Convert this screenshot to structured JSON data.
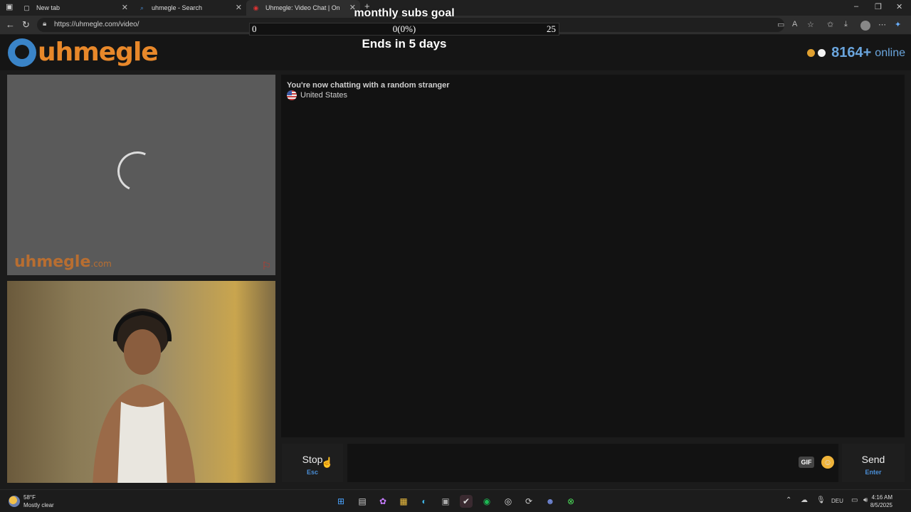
{
  "tabs": [
    {
      "title": "New tab"
    },
    {
      "title": "uhmegle - Search"
    },
    {
      "title": "Uhmegle: Video Chat | Omeg"
    }
  ],
  "address": {
    "url": "https://uhmegle.com/video/"
  },
  "overlay": {
    "goal_title": "monthly subs goal",
    "goal_min": "0",
    "goal_current": "0(0%)",
    "goal_max": "25",
    "goal_progress": 0,
    "goal_ends": "Ends in 5 days"
  },
  "site": {
    "logo_text": "uhmegle",
    "online_count": "8164+",
    "online_label": "online"
  },
  "video": {
    "watermark_main": "uhmegle",
    "watermark_tld": ".com"
  },
  "chat": {
    "status": "You're now chatting with a random stranger",
    "country": "United States"
  },
  "controls": {
    "stop_label": "Stop",
    "stop_key": "Esc",
    "gif_label": "GIF",
    "send_label": "Send",
    "send_key": "Enter"
  },
  "taskbar": {
    "temperature": "58°F",
    "weather": "Mostly clear",
    "language": "DEU",
    "time": "4:16 AM",
    "date": "8/5/2025"
  },
  "colors": {
    "brand_orange": "#e8882a",
    "brand_blue": "#3a84c8",
    "online_blue": "#6aa5dd",
    "key_blue": "#4a8ed6"
  }
}
